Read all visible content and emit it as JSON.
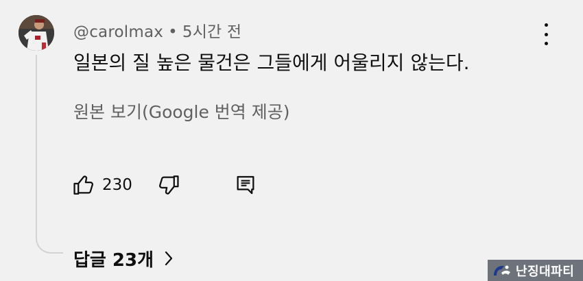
{
  "comment": {
    "author": "@carolmax",
    "separator": "•",
    "time_ago": "5시간 전",
    "text": "일본의 질 높은 물건은 그들에게 어울리지 않는다.",
    "translate_link": "원본 보기(Google 번역 제공)"
  },
  "actions": {
    "like_count": "230",
    "icons": [
      "thumbs-up-icon",
      "thumbs-down-icon",
      "reply-icon"
    ]
  },
  "replies": {
    "label": "답글 23개",
    "icon": "chevron-right-icon"
  },
  "menu": {
    "icon": "more-vert-icon"
  },
  "watermark": {
    "text": "난징대파티"
  },
  "colors": {
    "background": "#f1f1f1",
    "primary_text": "#0f0f0f",
    "secondary_text": "#606060",
    "thread_line": "#d3d3d3",
    "watermark_bg": "#6e737b"
  }
}
